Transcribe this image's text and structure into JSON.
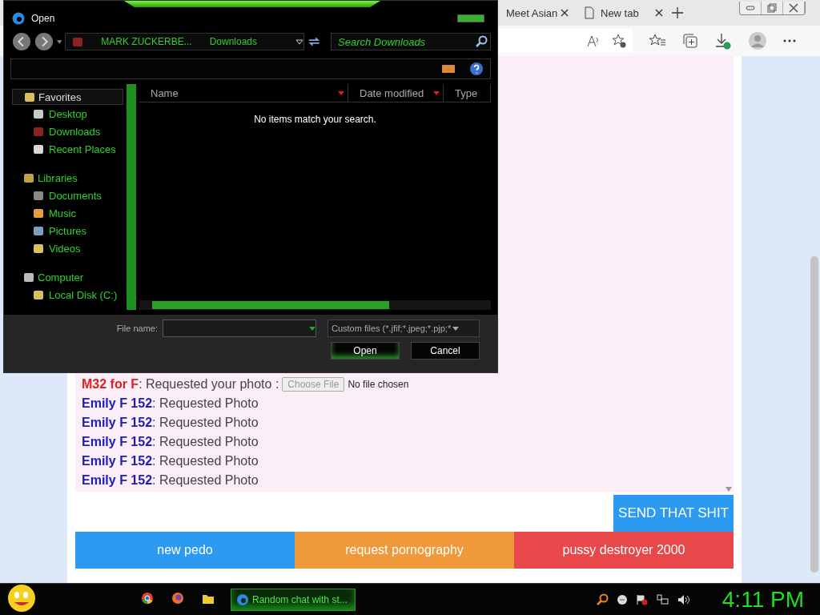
{
  "browser": {
    "tabs": [
      {
        "title": "Meet Asian"
      },
      {
        "title": "New tab"
      }
    ]
  },
  "dialog": {
    "title": "Open",
    "breadcrumb": [
      "MARK ZUCKERBE...",
      "Downloads"
    ],
    "search": {
      "placeholder": "Search Downloads"
    },
    "navigation": [
      {
        "label": "Favorites",
        "children": [
          {
            "label": "Desktop"
          },
          {
            "label": "Downloads"
          },
          {
            "label": "Recent Places"
          }
        ]
      },
      {
        "label": "Libraries",
        "children": [
          {
            "label": "Documents"
          },
          {
            "label": "Music"
          },
          {
            "label": "Pictures"
          },
          {
            "label": "Videos"
          }
        ]
      },
      {
        "label": "Computer",
        "children": [
          {
            "label": "Local Disk (C:)"
          }
        ]
      }
    ],
    "columns": [
      "Name",
      "Date modified",
      "Type"
    ],
    "empty_message": "No items match your search.",
    "file_name_label": "File name:",
    "file_type": "Custom files (*.jfif;*.jpeg;*.pjp;*",
    "buttons": [
      "Open",
      "Cancel"
    ]
  },
  "chat": {
    "messages": [
      {
        "kind": "photo_request",
        "sender": "M32 for F",
        "color": "#dd2020",
        "text": ": Requested your photo :",
        "file_button": "Choose File",
        "file_status": "No file chosen"
      },
      {
        "kind": "text",
        "sender": "Emily F 152",
        "color": "#1c1cb8",
        "text": ": Requested Photo"
      },
      {
        "kind": "text",
        "sender": "Emily F 152",
        "color": "#1c1cb8",
        "text": ": Requested Photo"
      },
      {
        "kind": "text",
        "sender": "Emily F 152",
        "color": "#1c1cb8",
        "text": ": Requested Photo"
      },
      {
        "kind": "text",
        "sender": "Emily F 152",
        "color": "#1c1cb8",
        "text": ": Requested Photo"
      },
      {
        "kind": "text",
        "sender": "Emily F 152",
        "color": "#1c1cb8",
        "text": ": Requested Photo"
      }
    ],
    "send_button": "SEND THAT SHIT",
    "actions": [
      {
        "label": "new pedo",
        "color": "#2b9af0"
      },
      {
        "label": "request pornography",
        "color": "#f0993a"
      },
      {
        "label": "pussy destroyer 2000",
        "color": "#e8484a"
      }
    ]
  },
  "taskbar": {
    "window_button": "Random chat with st...",
    "clock": "4:11 PM"
  }
}
